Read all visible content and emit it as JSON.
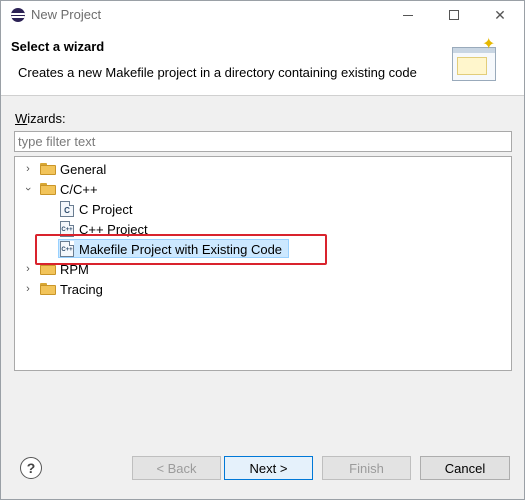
{
  "window": {
    "title": "New Project"
  },
  "header": {
    "title": "Select a wizard",
    "description": "Creates a new Makefile project in a directory containing existing code"
  },
  "wizards": {
    "label_accel": "W",
    "label_rest": "izards:",
    "filter_placeholder": "type filter text"
  },
  "tree": {
    "items": [
      {
        "label": "General",
        "icon": "folder-icon",
        "expanded": false,
        "level": 0
      },
      {
        "label": "C/C++",
        "icon": "folder-icon",
        "expanded": true,
        "level": 0
      },
      {
        "label": "C Project",
        "icon": "c-project-icon",
        "level": 1
      },
      {
        "label": "C++ Project",
        "icon": "cpp-project-icon",
        "level": 1
      },
      {
        "label": "Makefile Project with Existing Code",
        "icon": "makefile-project-icon",
        "level": 1,
        "selected": true
      },
      {
        "label": "RPM",
        "icon": "folder-icon",
        "expanded": false,
        "level": 0
      },
      {
        "label": "Tracing",
        "icon": "folder-icon",
        "expanded": false,
        "level": 0
      }
    ]
  },
  "buttons": {
    "back": "< Back",
    "next": "Next >",
    "finish": "Finish",
    "cancel": "Cancel",
    "help": "?"
  },
  "colors": {
    "highlight": "#d9232d",
    "selection": "#cce8ff",
    "accent": "#0078d7"
  }
}
